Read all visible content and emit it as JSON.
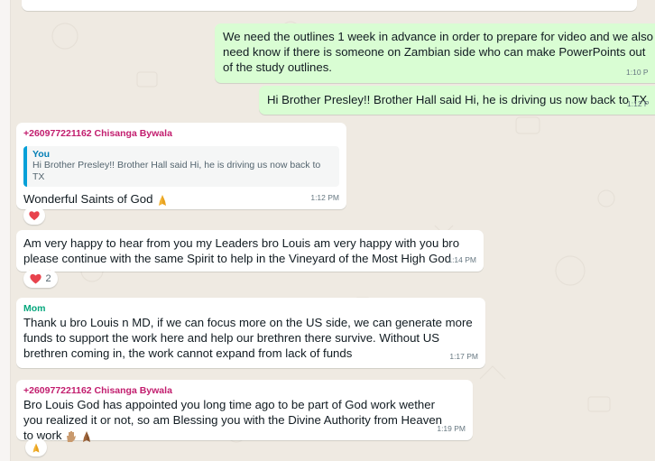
{
  "messages": [
    {
      "text": "We need the outlines 1 week in advance in order to prepare for video and we also need know if there is someone on Zambian side who can make PowerPoints out of the study outlines.",
      "time": "1:10 P"
    },
    {
      "text": "Hi Brother Presley!! Brother Hall said Hi, he is driving us now back to TX",
      "time": "1:12 P"
    },
    {
      "sender": "+260977221162 Chisanga Bywala",
      "quote_name": "You",
      "quote_text": "Hi Brother Presley!! Brother Hall said Hi, he is driving us now back to TX",
      "text": "Wonderful Saints of God",
      "time": "1:12 PM",
      "reaction": "heart"
    },
    {
      "text": "Am very happy to hear from you my Leaders bro Louis am very happy with you bro please continue with the same Spirit to help in the Vineyard of the Most High God",
      "time": "1:14 PM",
      "reaction": "heart",
      "reaction_count": "2"
    },
    {
      "sender": "Mom",
      "text": "Thank u bro Louis n MD, if we can focus more on the US side, we can generate more funds to support the work here and help our brethren there survive. Without US brethren coming in, the work cannot expand from lack of funds",
      "time": "1:17 PM"
    },
    {
      "sender": "+260977221162 Chisanga Bywala",
      "text": "Bro Louis God has appointed you long time ago  to be part of God work wether you realized it or not,  so am Blessing you with the Divine Authority from Heaven to work",
      "time": "1:19 PM",
      "reaction": "folded-hands"
    }
  ],
  "colors": {
    "chat_bg": "#efeae2",
    "outgoing": "#d9fdd3",
    "incoming": "#ffffff",
    "sender_pink": "#c21d6e",
    "sender_green": "#06a77d",
    "quote_bar": "#06a0d8"
  }
}
